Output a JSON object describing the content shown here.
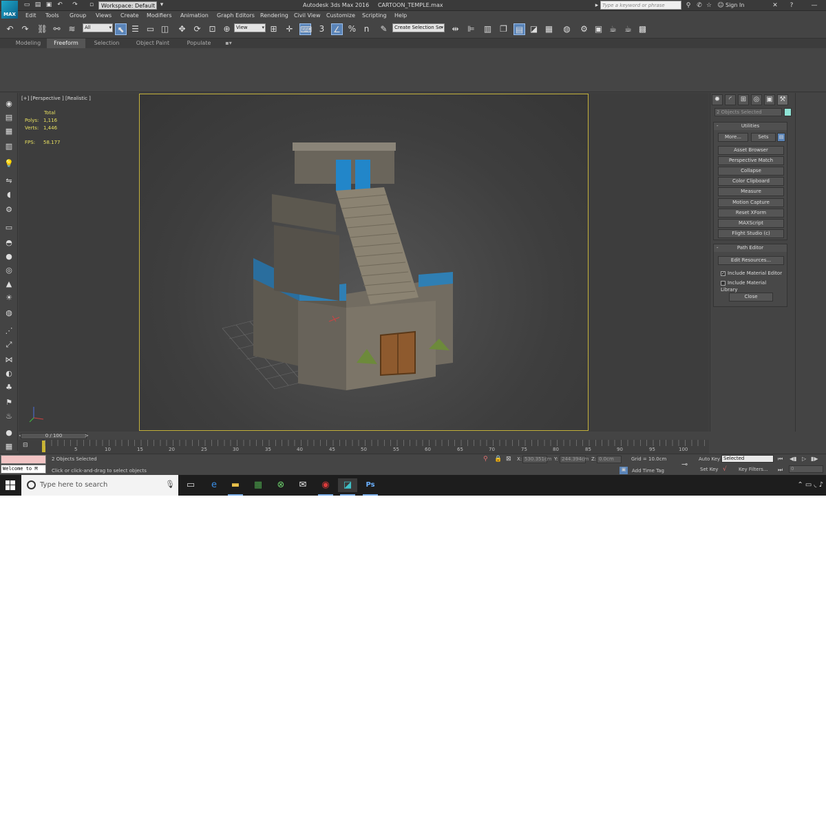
{
  "title_bar": {
    "app_logo": "MAX",
    "workspace": "Workspace: Default",
    "window_title": "Autodesk 3ds Max 2016     CARTOON_TEMPLE.max",
    "search_placeholder": "Type a keyword or phrase",
    "sign_in": "Sign In",
    "help": "?"
  },
  "menu": [
    "Edit",
    "Tools",
    "Group",
    "Views",
    "Create",
    "Modifiers",
    "Animation",
    "Graph Editors",
    "Rendering",
    "Civil View",
    "Customize",
    "Scripting",
    "Help"
  ],
  "toolbar": {
    "selection_filter": "All",
    "reference_coord": "View",
    "named_selection": "Create Selection Se",
    "snap_label": "3",
    "angle_snap_label": "%",
    "spinner_snap_label": "n"
  },
  "ribbon_tabs": [
    "Modeling",
    "Freeform",
    "Selection",
    "Object Paint",
    "Populate"
  ],
  "viewport": {
    "label": "[+] [Perspective ] [Realistic ]",
    "stats_header": "Total",
    "polys_label": "Polys:",
    "polys_value": "1,116",
    "verts_label": "Verts:",
    "verts_value": "1,446",
    "fps_label": "FPS:",
    "fps_value": "58.177"
  },
  "command_panel": {
    "selection_field": "2 Objects Selected",
    "swatch_color": "#8fe3d5",
    "utilities": {
      "title": "Utilities",
      "more": "More...",
      "sets": "Sets",
      "buttons": [
        "Asset Browser",
        "Perspective Match",
        "Collapse",
        "Color Clipboard",
        "Measure",
        "Motion Capture",
        "Reset XForm",
        "MAXScript",
        "Flight Studio (c)"
      ]
    },
    "path_editor": {
      "title": "Path Editor",
      "edit_resources": "Edit Resources...",
      "include_material_editor": "Include Material Editor",
      "include_material_library": "Include Material Library",
      "close": "Close"
    }
  },
  "timeline": {
    "slider": "0 / 100",
    "ticks": [
      "5",
      "10",
      "15",
      "20",
      "25",
      "30",
      "35",
      "40",
      "45",
      "50",
      "55",
      "60",
      "65",
      "70",
      "75",
      "80",
      "85",
      "90",
      "95",
      "100"
    ]
  },
  "status": {
    "maxscript_listener": "Welcome to M",
    "selection": "2 Objects Selected",
    "prompt": "Click or click-and-drag to select objects",
    "x_label": "X:",
    "x_value": "530.351cm",
    "y_label": "Y:",
    "y_value": "244.394cm",
    "z_label": "Z:",
    "z_value": "0.0cm",
    "grid": "Grid = 10.0cm",
    "add_time_tag": "Add Time Tag",
    "auto_key": "Auto Key",
    "set_key": "Set Key",
    "key_mode": "Selected",
    "key_filters": "Key Filters...",
    "frame": "0"
  },
  "taskbar": {
    "search_placeholder": "Type here to search",
    "ps": "Ps"
  }
}
